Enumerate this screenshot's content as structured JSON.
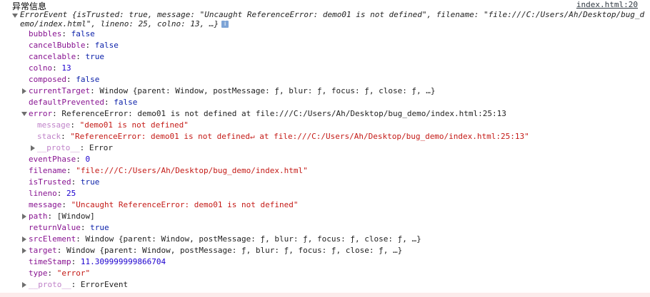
{
  "label": "异常信息",
  "source_link": "index.html:20",
  "summary": {
    "line1": "ErrorEvent {isTrusted: true, message: \"Uncaught ReferenceError: demo01 is not defined\", filename: \"file:///C:/Users/Ah/Desktop/bug_d",
    "line2": "emo/index.html\", lineno: 25, colno: 13, …}",
    "info_icon": "i"
  },
  "rows": {
    "bubbles": {
      "key": "bubbles",
      "value": "false"
    },
    "cancelBubble": {
      "key": "cancelBubble",
      "value": "false"
    },
    "cancelable": {
      "key": "cancelable",
      "value": "true"
    },
    "colno": {
      "key": "colno",
      "value": "13"
    },
    "composed": {
      "key": "composed",
      "value": "false"
    },
    "currentTarget": {
      "key": "currentTarget",
      "value": "Window {parent: Window, postMessage: ƒ, blur: ƒ, focus: ƒ, close: ƒ, …}"
    },
    "defaultPrevented": {
      "key": "defaultPrevented",
      "value": "false"
    },
    "error": {
      "key": "error",
      "value": "ReferenceError: demo01 is not defined at file:///C:/Users/Ah/Desktop/bug_demo/index.html:25:13"
    },
    "error_message": {
      "key": "message",
      "value": "\"demo01 is not defined\""
    },
    "error_stack": {
      "key": "stack",
      "value": "\"ReferenceError: demo01 is not defined↵    at file:///C:/Users/Ah/Desktop/bug_demo/index.html:25:13\""
    },
    "error_proto": {
      "key": "__proto__",
      "value": "Error"
    },
    "eventPhase": {
      "key": "eventPhase",
      "value": "0"
    },
    "filename": {
      "key": "filename",
      "value": "\"file:///C:/Users/Ah/Desktop/bug_demo/index.html\""
    },
    "isTrusted": {
      "key": "isTrusted",
      "value": "true"
    },
    "lineno": {
      "key": "lineno",
      "value": "25"
    },
    "message": {
      "key": "message",
      "value": "\"Uncaught ReferenceError: demo01 is not defined\""
    },
    "path": {
      "key": "path",
      "value": "[Window]"
    },
    "returnValue": {
      "key": "returnValue",
      "value": "true"
    },
    "srcElement": {
      "key": "srcElement",
      "value": "Window {parent: Window, postMessage: ƒ, blur: ƒ, focus: ƒ, close: ƒ, …}"
    },
    "target": {
      "key": "target",
      "value": "Window {parent: Window, postMessage: ƒ, blur: ƒ, focus: ƒ, close: ƒ, …}"
    },
    "timeStamp": {
      "key": "timeStamp",
      "value": "11.309999999866704"
    },
    "type": {
      "key": "type",
      "value": "\"error\""
    },
    "proto": {
      "key": "__proto__",
      "value": "ErrorEvent"
    }
  },
  "colors": {
    "key": "#881391",
    "string": "#c41a16",
    "number": "#1c00cf",
    "boolean": "#0d22aa",
    "error_band": "#fcebeb"
  }
}
